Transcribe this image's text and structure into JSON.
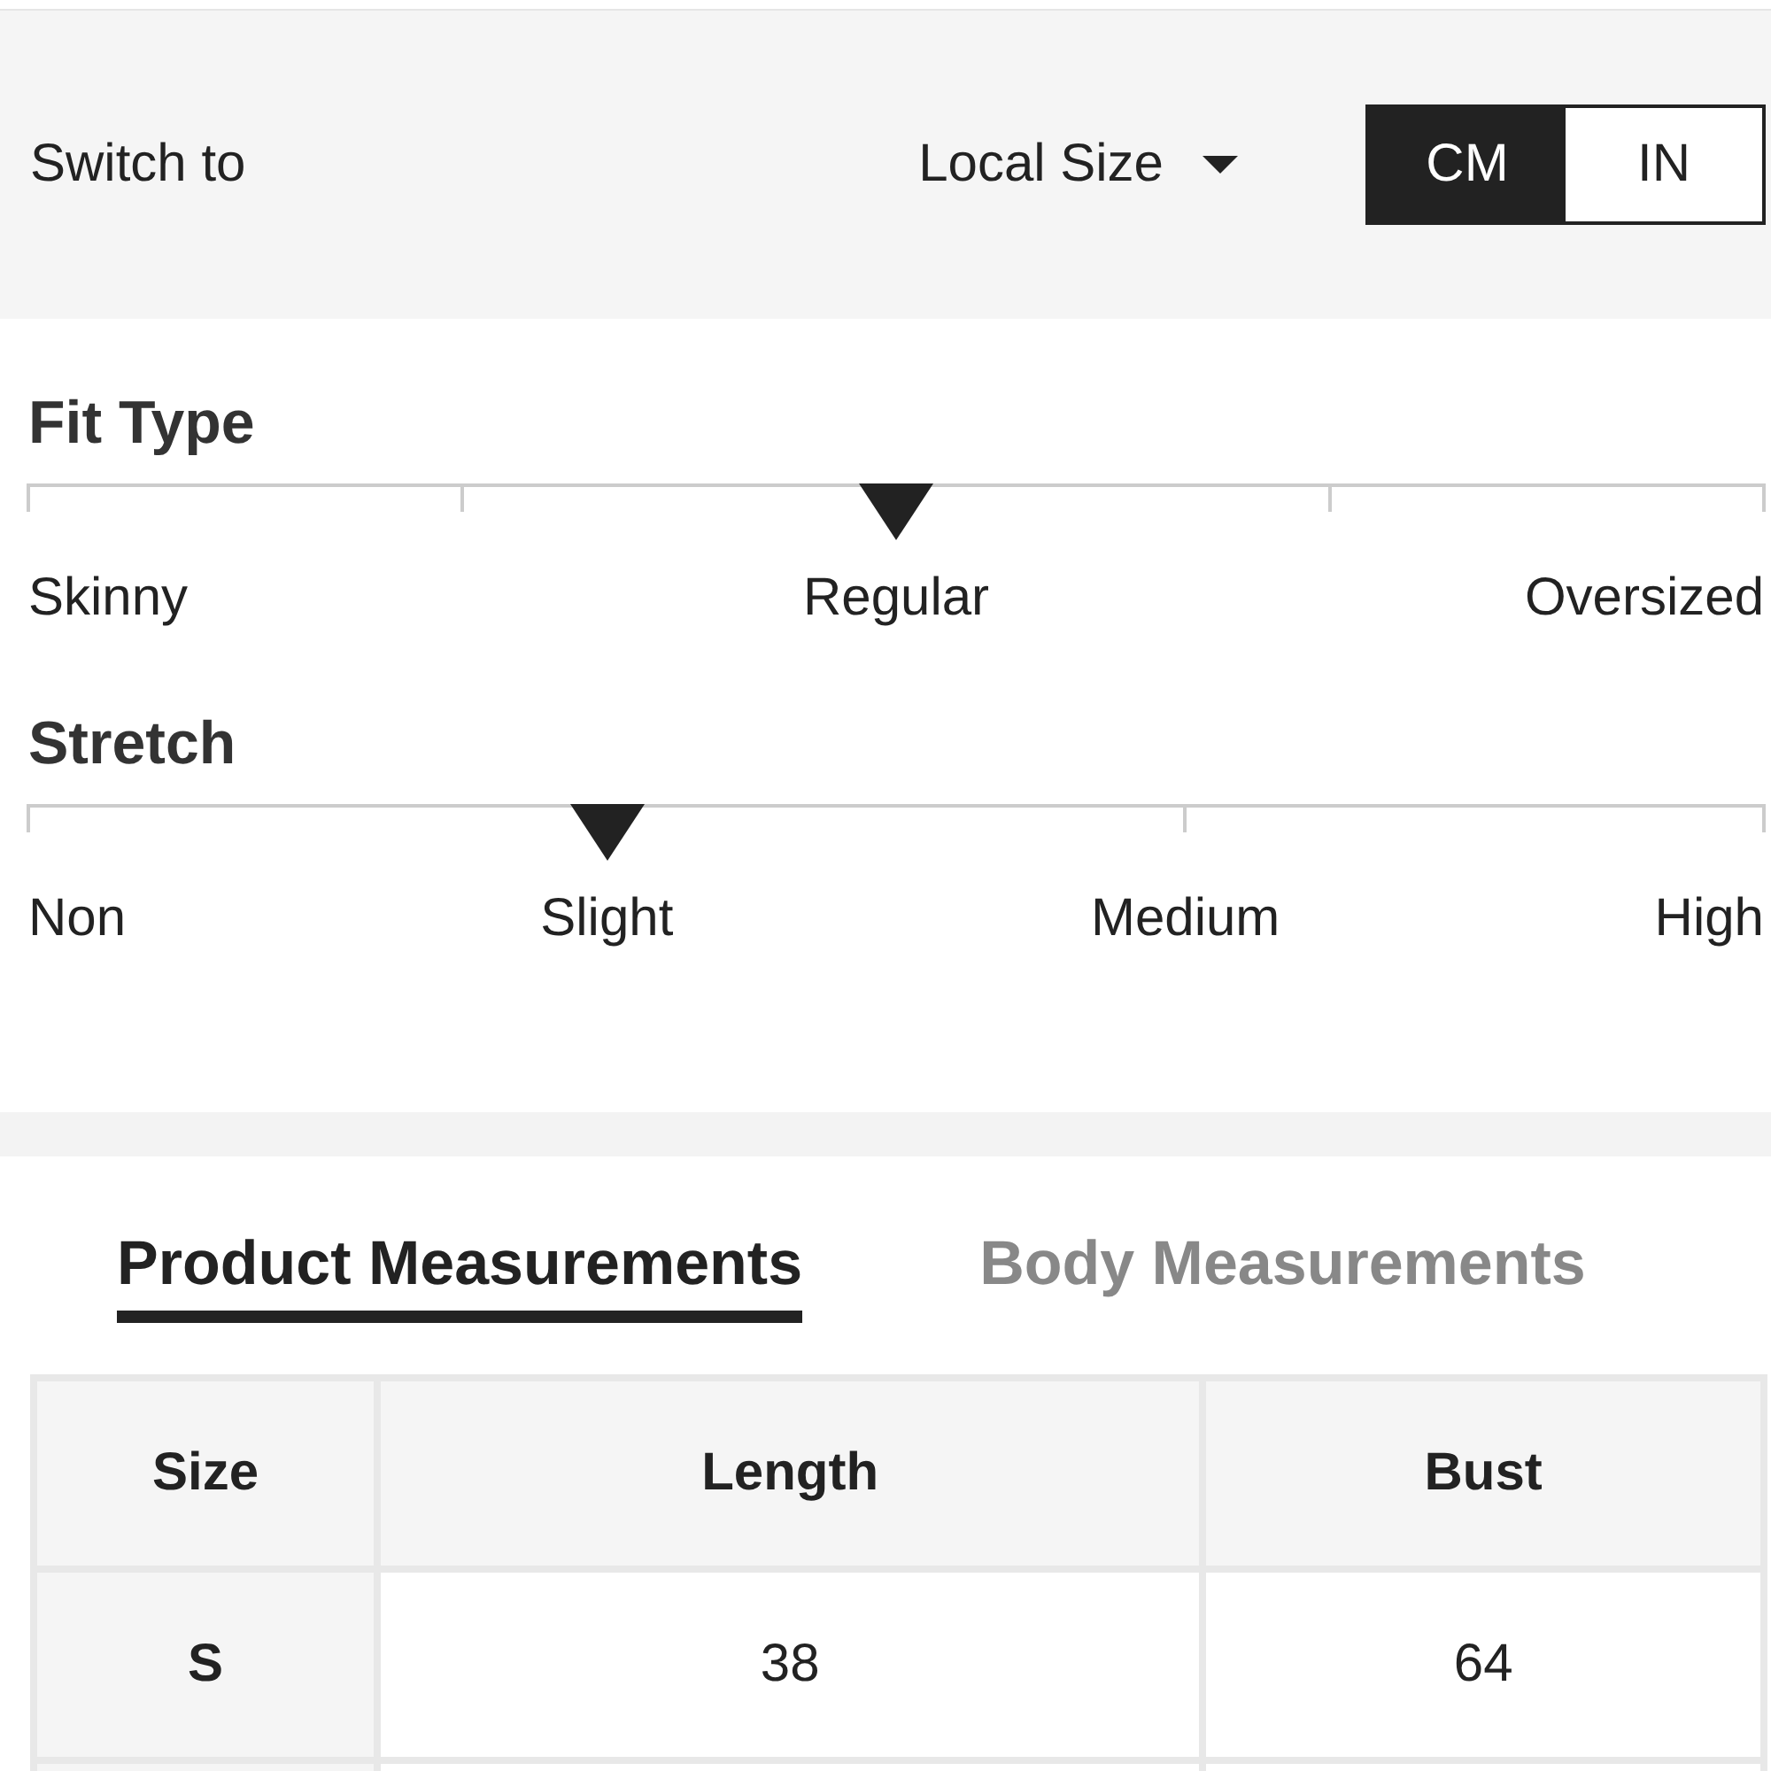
{
  "switch_bar": {
    "label": "Switch to",
    "size_dropdown": "Local Size",
    "units": [
      {
        "label": "CM",
        "selected": true
      },
      {
        "label": "IN",
        "selected": false
      }
    ]
  },
  "scales": [
    {
      "title": "Fit Type",
      "options": [
        {
          "label": "Skinny",
          "selected": false
        },
        {
          "label": "Regular",
          "selected": true
        },
        {
          "label": "Oversized",
          "selected": false
        }
      ]
    },
    {
      "title": "Stretch",
      "options": [
        {
          "label": "Non",
          "selected": false
        },
        {
          "label": "Slight",
          "selected": true
        },
        {
          "label": "Medium",
          "selected": false
        },
        {
          "label": "High",
          "selected": false
        }
      ]
    }
  ],
  "tabs": [
    {
      "label": "Product Measurements",
      "selected": true
    },
    {
      "label": "Body Measurements",
      "selected": false
    }
  ],
  "table": {
    "columns": [
      "Size",
      "Length",
      "Bust"
    ],
    "rows": [
      [
        "S",
        "38",
        "64"
      ]
    ]
  }
}
